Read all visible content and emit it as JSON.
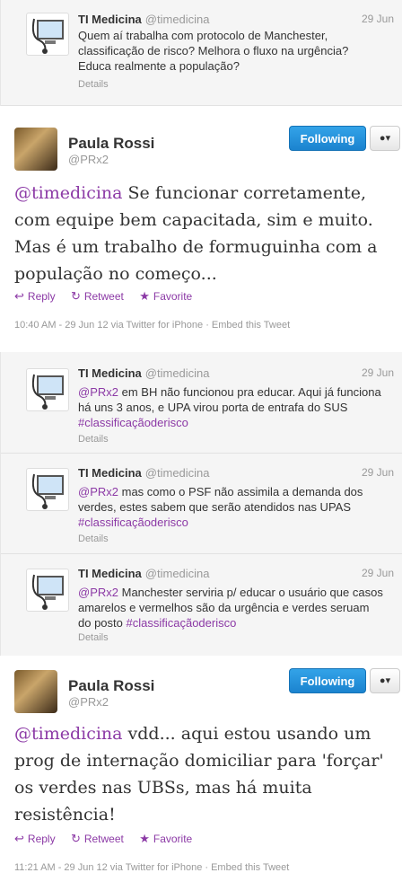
{
  "context_top": {
    "name": "TI Medicina",
    "handle": "@timedicina",
    "date": "29 Jun",
    "text": "Quem aí trabalha com protocolo de Manchester, classificação de risco? Melhora o fluxo na urgência? Educa realmente a população?",
    "details": "Details"
  },
  "tweet1": {
    "name": "Paula Rossi",
    "handle": "@PRx2",
    "follow_label": "Following",
    "user_menu": "▾",
    "mention": "@timedicina",
    "text": " Se funcionar corretamente, com equipe bem capacitada, sim e muito. Mas é um trabalho de formuguinha com a população no começo...",
    "reply": "Reply",
    "retweet": "Retweet",
    "favorite": "Favorite",
    "meta": "10:40 AM - 29 Jun 12 via Twitter for iPhone · Embed this Tweet"
  },
  "replies": [
    {
      "name": "TI Medicina",
      "handle": "@timedicina",
      "date": "29 Jun",
      "mention": "@PRx2",
      "text": " em BH não funcionou pra educar. Aqui já funciona há uns 3 anos, e UPA virou porta de entrafa do SUS ",
      "hashtag": "#classificaçãoderisco",
      "details": "Details"
    },
    {
      "name": "TI Medicina",
      "handle": "@timedicina",
      "date": "29 Jun",
      "mention": "@PRx2",
      "text": " mas como o PSF não assimila a demanda dos verdes, estes sabem que serão atendidos nas UPAS ",
      "hashtag": "#classificaçãoderisco",
      "details": "Details"
    },
    {
      "name": "TI Medicina",
      "handle": "@timedicina",
      "date": "29 Jun",
      "mention": "@PRx2",
      "text": " Manchester serviria p/ educar o usuário que casos amarelos e vermelhos são da urgência e verdes seruam do posto ",
      "hashtag": "#classificaçãoderisco",
      "details": "Details"
    }
  ],
  "tweet2": {
    "name": "Paula Rossi",
    "handle": "@PRx2",
    "follow_label": "Following",
    "user_menu": "▾",
    "mention": "@timedicina",
    "text": " vdd... aqui estou usando um prog de internação domiciliar para 'forçar' os verdes nas UBSs, mas há muita resistência!",
    "reply": "Reply",
    "retweet": "Retweet",
    "favorite": "Favorite",
    "meta": "11:21 AM - 29 Jun 12 via Twitter for iPhone · Embed this Tweet"
  },
  "colors": {
    "accent": "#8c3aa6",
    "follow_blue": "#1b83cf",
    "context_bg": "#f5f5f5"
  },
  "icons": {
    "reply": "reply-icon",
    "retweet": "retweet-icon",
    "favorite": "star-icon",
    "user": "user-icon"
  }
}
